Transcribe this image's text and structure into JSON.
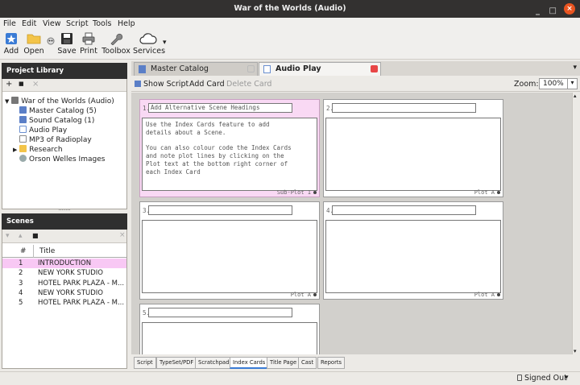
{
  "window": {
    "title": "War of the Worlds (Audio)",
    "minimize": "_",
    "maximize": "□",
    "close": "×"
  },
  "menu": [
    "File",
    "Edit",
    "View",
    "Script",
    "Tools",
    "Help"
  ],
  "toolbar": {
    "add": "Add",
    "open": "Open",
    "save": "Save",
    "print": "Print",
    "toolbox": "Toolbox",
    "services": "Services",
    "services_arrow": "▾"
  },
  "library": {
    "title": "Project Library",
    "tools": [
      "+",
      "■",
      "×"
    ],
    "root": "War of the Worlds (Audio)",
    "items": [
      "Master Catalog (5)",
      "Sound Catalog (1)",
      "Audio Play",
      "MP3 of Radioplay",
      "Research",
      "Orson Welles Images"
    ],
    "grip": "......."
  },
  "scenes": {
    "title": "Scenes",
    "tools": [
      "▾",
      "▴",
      "■",
      "×"
    ],
    "col_num": "#",
    "col_title": "Title",
    "rows": [
      {
        "num": "1",
        "title": "INTRODUCTION"
      },
      {
        "num": "2",
        "title": "NEW YORK STUDIO"
      },
      {
        "num": "3",
        "title": "HOTEL PARK PLAZA - M..."
      },
      {
        "num": "4",
        "title": "NEW YORK STUDIO"
      },
      {
        "num": "5",
        "title": "HOTEL PARK PLAZA - M..."
      }
    ]
  },
  "tabs": {
    "master": "Master Catalog",
    "audio": "Audio Play",
    "overflow": "▾"
  },
  "subbar": {
    "show_script": "Show Script",
    "add_card": "Add Card",
    "delete_card": "Delete Card",
    "zoom_label": "Zoom:",
    "zoom_value": "100%",
    "zoom_arrow": "▾"
  },
  "cards": [
    {
      "num": "1.",
      "heading": "Add Alternative Scene Headings",
      "body": "Use the Index Cards feature to add\ndetails about a Scene.\n\nYou can also colour code the Index Cards\nand note plot lines by clicking on the\nPlot text at the bottom right corner of\neach Index Card",
      "plot": "Sub-Plot 1"
    },
    {
      "num": "2.",
      "heading": "",
      "body": "",
      "plot": "Plot A"
    },
    {
      "num": "3.",
      "heading": "",
      "body": "",
      "plot": "Plot A"
    },
    {
      "num": "4.",
      "heading": "",
      "body": "",
      "plot": "Plot A"
    },
    {
      "num": "5.",
      "heading": "",
      "body": "",
      "plot": ""
    }
  ],
  "bottom_tabs": [
    "Script",
    "TypeSet/PDF",
    "Scratchpad",
    "Index Cards",
    "Title Page",
    "Cast",
    "Reports"
  ],
  "status": {
    "signed_out": "Signed Out",
    "arrow": "▾"
  },
  "colors": {
    "selected_card": "#f9d9f4",
    "selected_row": "#f8c8f4",
    "titlebar": "#333130",
    "accent": "#3a7bd5",
    "close": "#e95420"
  }
}
